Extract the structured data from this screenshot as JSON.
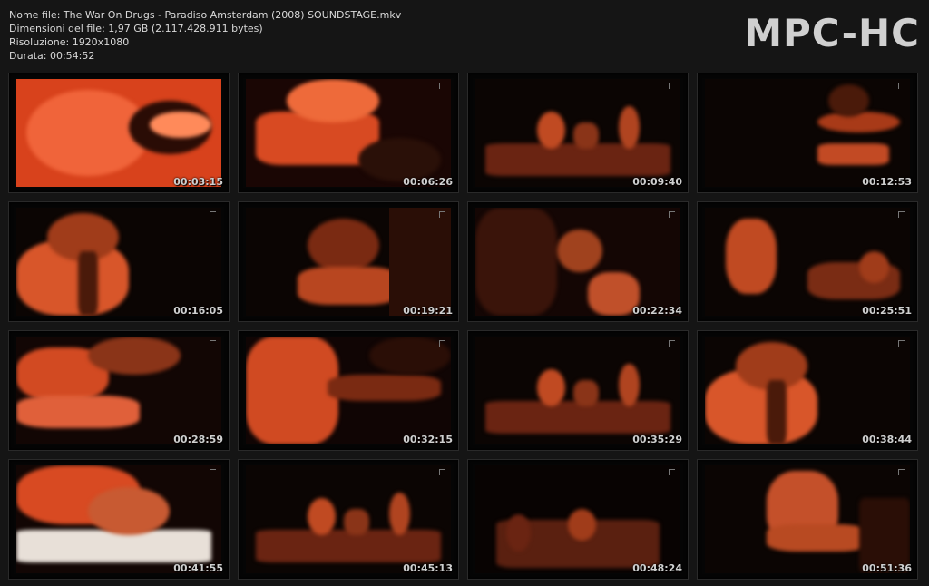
{
  "info": {
    "filename": "Nome file: The War On Drugs - Paradiso Amsterdam (2008) SOUNDSTAGE.mkv",
    "filesize": "Dimensioni del file: 1,97 GB (2.117.428.911 bytes)",
    "resolution": "Risoluzione: 1920x1080",
    "duration": "Durata: 00:54:52"
  },
  "logo": "MPC-HC",
  "colors": {
    "accent": "#e0502a",
    "background": "#151515"
  },
  "thumbnails": [
    {
      "time": "00:03:15",
      "scene": "guitar-closeup"
    },
    {
      "time": "00:06:26",
      "scene": "guitar-player"
    },
    {
      "time": "00:09:40",
      "scene": "stage-wide"
    },
    {
      "time": "00:12:53",
      "scene": "drummer"
    },
    {
      "time": "00:16:05",
      "scene": "singer-mic"
    },
    {
      "time": "00:19:21",
      "scene": "guitarist"
    },
    {
      "time": "00:22:34",
      "scene": "audience"
    },
    {
      "time": "00:25:51",
      "scene": "band-stage"
    },
    {
      "time": "00:28:59",
      "scene": "guitar-playing"
    },
    {
      "time": "00:32:15",
      "scene": "guitar-neck"
    },
    {
      "time": "00:35:29",
      "scene": "stage-wide"
    },
    {
      "time": "00:38:44",
      "scene": "singer-mic"
    },
    {
      "time": "00:41:55",
      "scene": "keyboard"
    },
    {
      "time": "00:45:13",
      "scene": "stage-wide"
    },
    {
      "time": "00:48:24",
      "scene": "stage-lights"
    },
    {
      "time": "00:51:36",
      "scene": "singer-guitar"
    }
  ]
}
